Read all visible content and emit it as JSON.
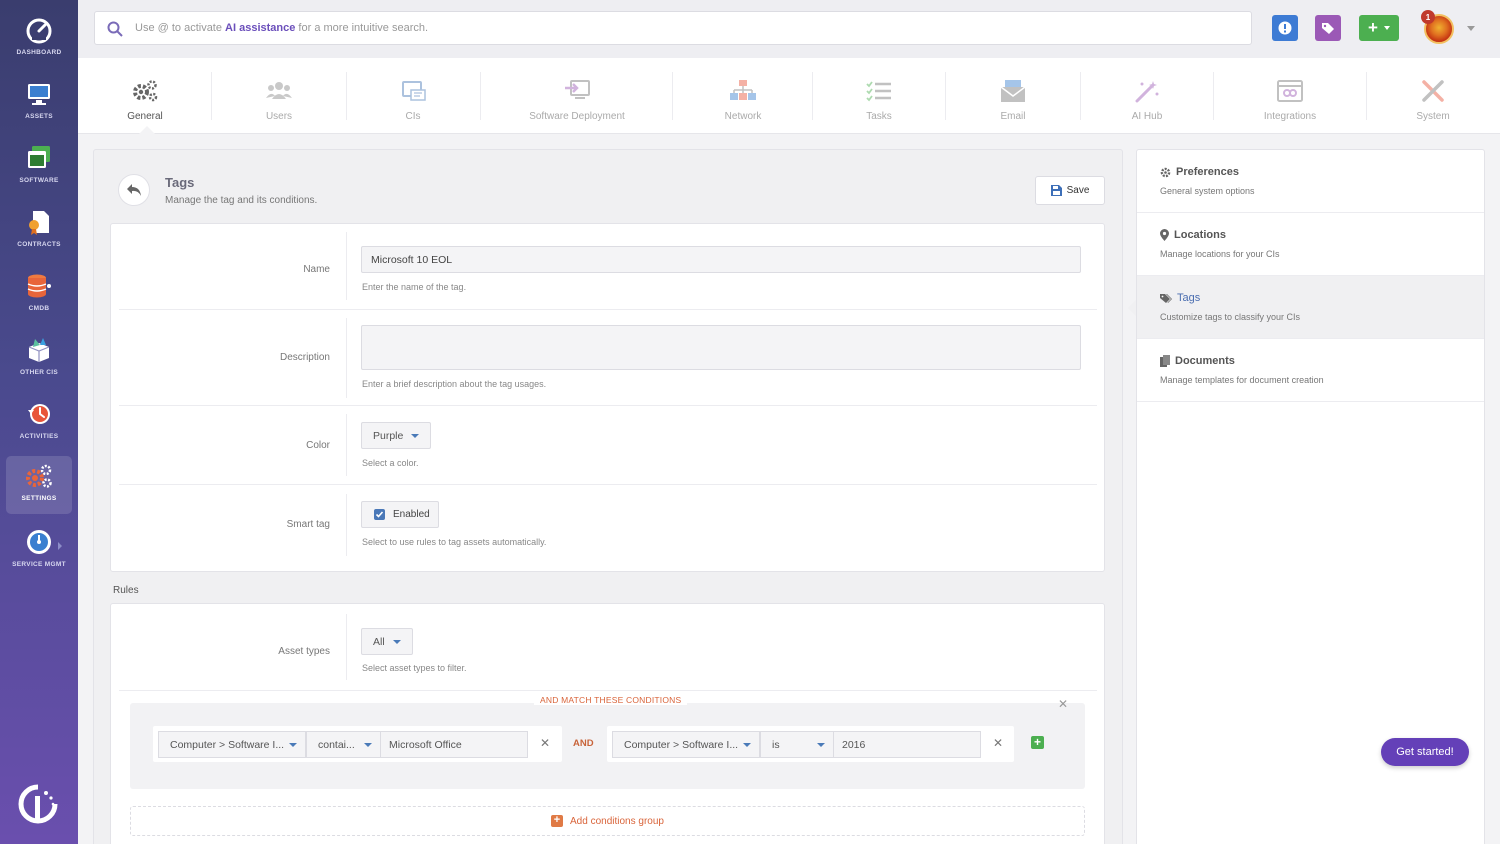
{
  "sidebar": {
    "items": [
      {
        "label": "DASHBOARD",
        "icon": "gauge-icon"
      },
      {
        "label": "ASSETS",
        "icon": "monitor-icon"
      },
      {
        "label": "SOFTWARE",
        "icon": "software-window-icon"
      },
      {
        "label": "CONTRACTS",
        "icon": "contract-document-icon"
      },
      {
        "label": "CMDB",
        "icon": "database-icon"
      },
      {
        "label": "OTHER CIS",
        "icon": "open-box-icon"
      },
      {
        "label": "ACTIVITIES",
        "icon": "history-clock-icon"
      },
      {
        "label": "SETTINGS",
        "icon": "gears-icon"
      },
      {
        "label": "SERVICE MGMT",
        "icon": "service-gauge-icon"
      }
    ],
    "active": "SETTINGS"
  },
  "search": {
    "prefix": "Use @ to activate ",
    "ai_label": "AI assistance",
    "suffix": " for a more intuitive search."
  },
  "topbar": {
    "notification_count": "1",
    "colors": {
      "info": "#3d7bd4",
      "tag": "#9b59b6",
      "add": "#4caf50"
    }
  },
  "tabs": [
    {
      "label": "General",
      "icon": "gears-icon",
      "active": true
    },
    {
      "label": "Users",
      "icon": "users-icon"
    },
    {
      "label": "CIs",
      "icon": "ci-window-icon"
    },
    {
      "label": "Software Deployment",
      "icon": "deploy-icon"
    },
    {
      "label": "Network",
      "icon": "network-icon"
    },
    {
      "label": "Tasks",
      "icon": "task-list-icon"
    },
    {
      "label": "Email",
      "icon": "email-icon"
    },
    {
      "label": "AI Hub",
      "icon": "magic-wand-icon"
    },
    {
      "label": "Integrations",
      "icon": "integrations-icon"
    },
    {
      "label": "System",
      "icon": "tools-icon"
    }
  ],
  "page": {
    "title": "Tags",
    "subtitle": "Manage the tag and its conditions.",
    "save_label": "Save"
  },
  "form": {
    "name": {
      "label": "Name",
      "value": "Microsoft 10 EOL",
      "hint": "Enter the name of the tag."
    },
    "description": {
      "label": "Description",
      "value": "",
      "hint": "Enter a brief description about the tag usages."
    },
    "color": {
      "label": "Color",
      "value": "Purple",
      "hint": "Select a color."
    },
    "smart_tag": {
      "label": "Smart tag",
      "checkbox_label": "Enabled",
      "checked": true,
      "hint": "Select to use rules to tag assets automatically."
    }
  },
  "rules": {
    "section_label": "Rules",
    "asset_types": {
      "label": "Asset types",
      "value": "All",
      "hint": "Select asset types to filter."
    },
    "conditions_heading": "AND MATCH THESE CONDITIONS",
    "conditions": [
      {
        "field": "Computer > Software I...",
        "operator": "contai...",
        "value": "Microsoft Office"
      },
      {
        "field": "Computer > Software I...",
        "operator": "is",
        "value": "2016"
      }
    ],
    "joiner": "AND",
    "add_group_label": "Add conditions group"
  },
  "settings_menu": [
    {
      "title": "Preferences",
      "subtitle": "General system options",
      "icon": "gear-icon"
    },
    {
      "title": "Locations",
      "subtitle": "Manage locations for your CIs",
      "icon": "map-pin-icon"
    },
    {
      "title": "Tags",
      "subtitle": "Customize tags to classify your CIs",
      "icon": "tags-icon",
      "active": true
    },
    {
      "title": "Documents",
      "subtitle": "Manage templates for document creation",
      "icon": "documents-icon"
    }
  ],
  "get_started_label": "Get started!"
}
